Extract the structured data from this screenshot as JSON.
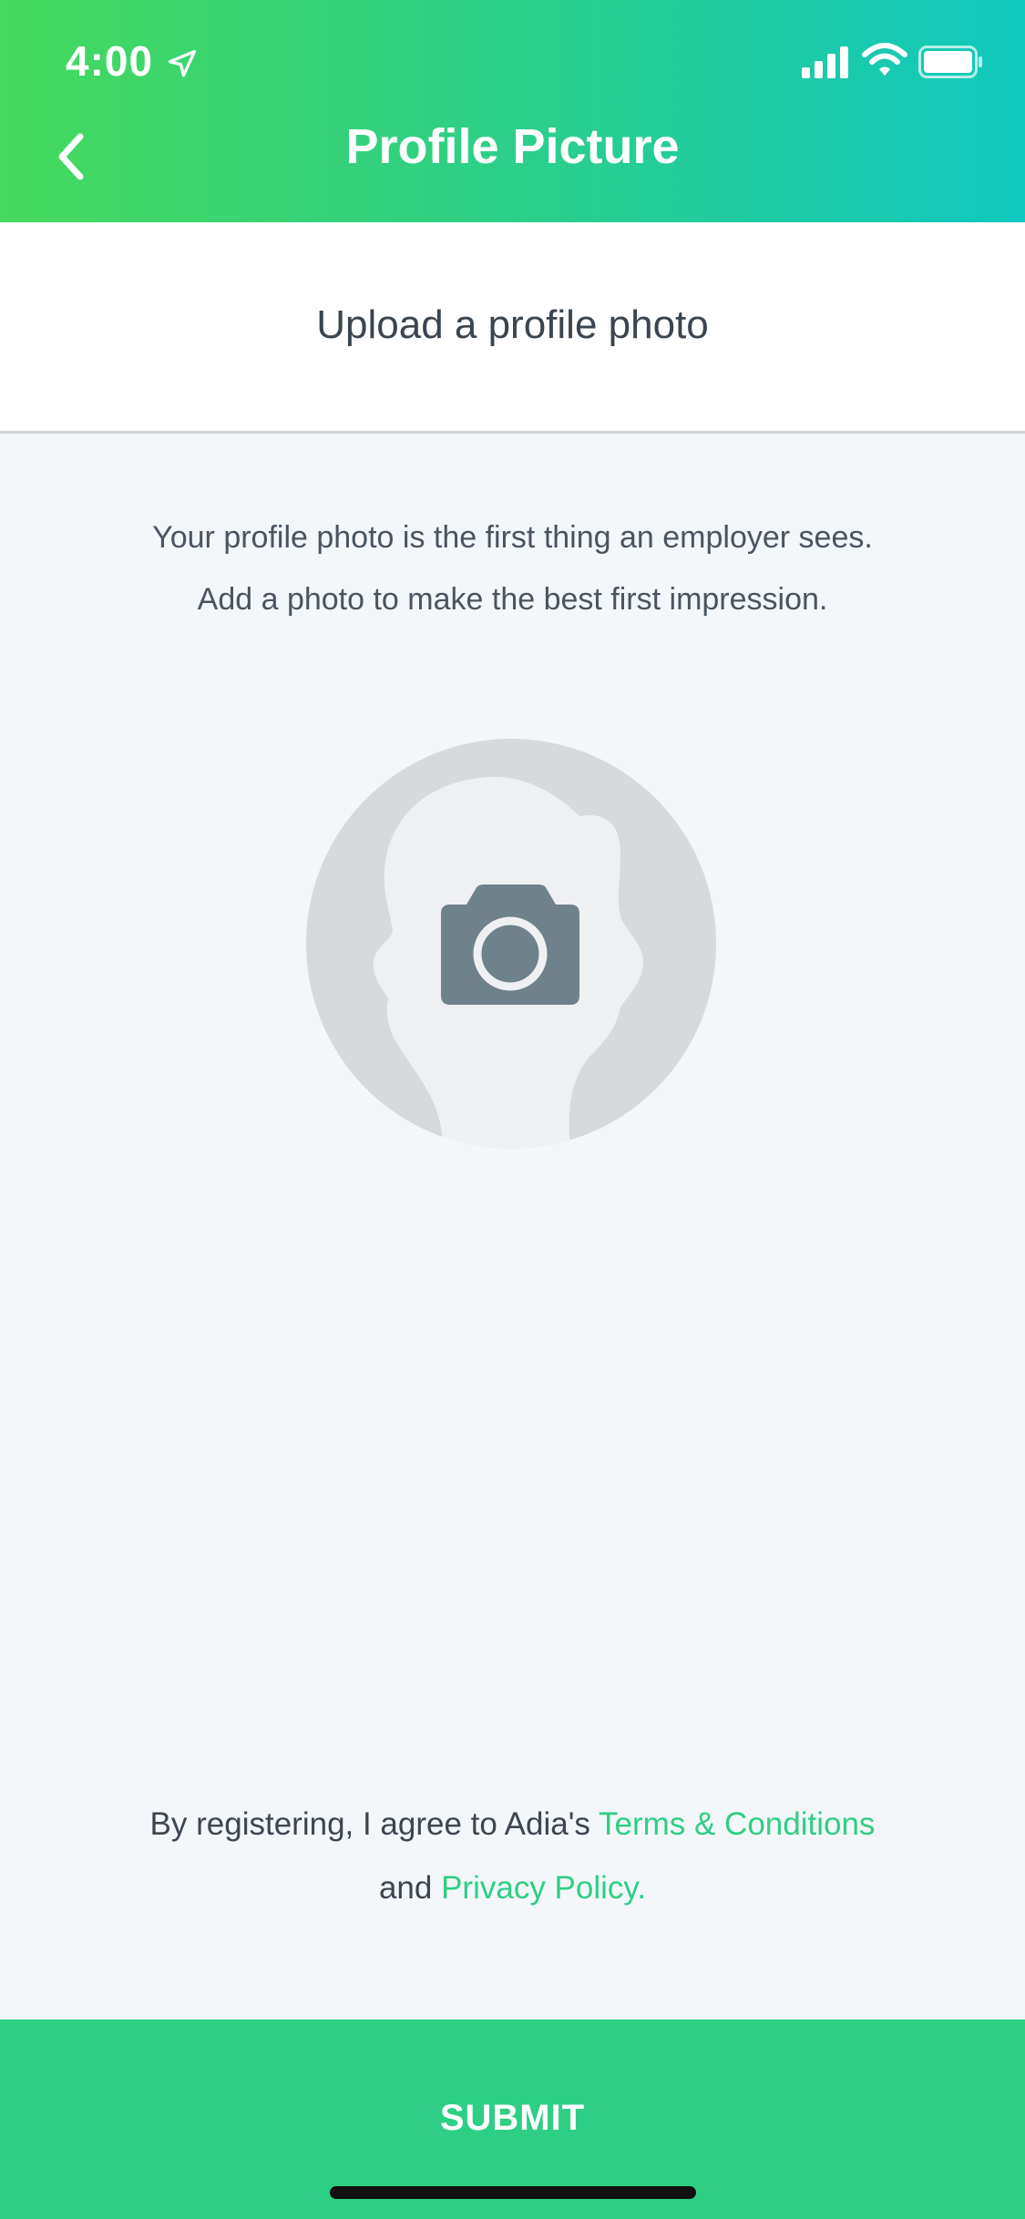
{
  "status_bar": {
    "time": "4:00",
    "icons": [
      "location-arrow-icon",
      "cellular-signal-icon",
      "wifi-icon",
      "battery-icon"
    ]
  },
  "nav": {
    "back_icon": "chevron-left-icon",
    "title": "Profile Picture"
  },
  "subheader": {
    "title": "Upload a profile photo"
  },
  "description": {
    "line1": "Your profile photo is the first thing an employer sees.",
    "line2": "Add a photo to make the best first impression."
  },
  "avatar": {
    "icon": "camera-icon",
    "placeholder_icon": "person-silhouette-icon"
  },
  "terms": {
    "prefix": "By registering, I agree to Adia's ",
    "terms_link": "Terms & Conditions",
    "and": "and ",
    "privacy_link": "Privacy Policy."
  },
  "submit": {
    "label": "SUBMIT"
  },
  "colors": {
    "header_gradient_start": "#45d95d",
    "header_gradient_end": "#10c8be",
    "accent": "#2ecf84",
    "background": "#f4f7fa",
    "camera": "#6f818a"
  }
}
